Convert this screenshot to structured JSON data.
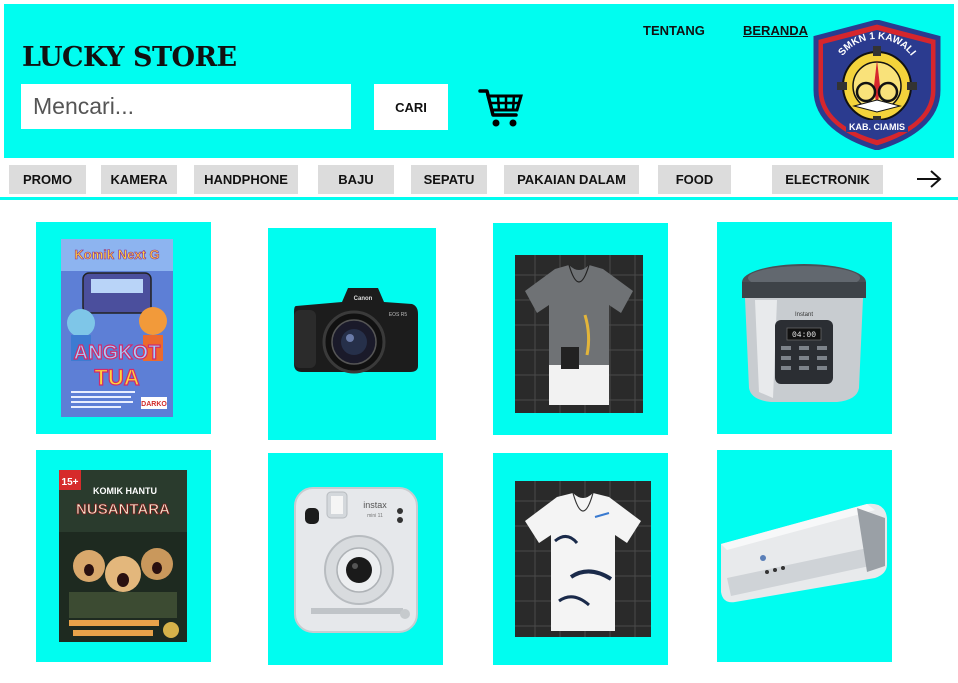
{
  "header": {
    "brand": "LUCKY STORE",
    "search_placeholder": "Mencari...",
    "search_button": "CARI",
    "nav": {
      "about": "TENTANG",
      "home": "BERANDA"
    },
    "logo": {
      "top_text": "SMKN 1 KAWALI",
      "bottom_text": "KAB. CIAMIS"
    }
  },
  "categories": [
    "PROMO",
    "KAMERA",
    "HANDPHONE",
    "BAJU",
    "SEPATU",
    "PAKAIAN DALAM",
    "FOOD",
    "ELECTRONIK"
  ],
  "products": [
    {
      "name": "komik-angkot-tua",
      "image": {
        "series": "Komik Next G",
        "title_1": "ANGKOT",
        "title_2": "TUA",
        "publisher": "DARKO"
      }
    },
    {
      "name": "canon-camera",
      "image": {
        "brand": "Canon",
        "model": "EOS R5"
      }
    },
    {
      "name": "grey-tshirt",
      "image": {}
    },
    {
      "name": "rice-cooker",
      "image": {
        "brand": "Instant",
        "display": "04:00"
      }
    },
    {
      "name": "komik-hantu-nusantara",
      "image": {
        "age": "15+",
        "title_1": "KOMIK HANTU",
        "title_2": "NUSANTARA"
      }
    },
    {
      "name": "instax-camera",
      "image": {
        "brand": "instax",
        "model": "mini 11"
      }
    },
    {
      "name": "white-tshirt",
      "image": {}
    },
    {
      "name": "air-conditioner",
      "image": {}
    }
  ],
  "colors": {
    "accent": "#00fdf0",
    "category_bg": "#dcdcdc",
    "logo_blue": "#2b3b8f",
    "logo_red": "#d6262d",
    "logo_yellow": "#f4d33b"
  },
  "icons": {
    "cart": "cart-icon",
    "next": "arrow-right-icon"
  }
}
